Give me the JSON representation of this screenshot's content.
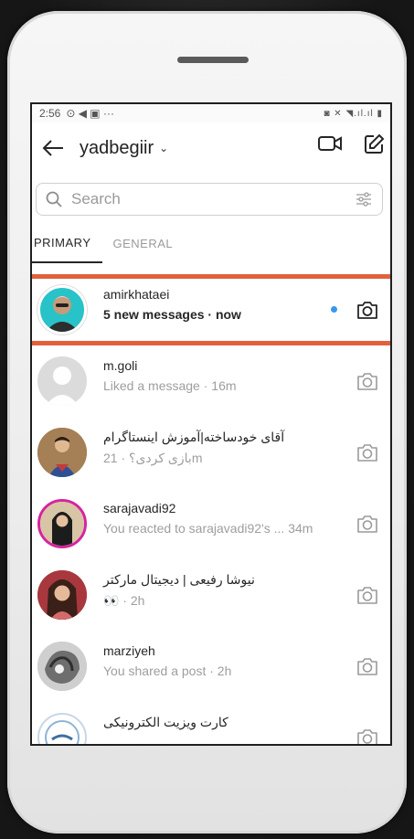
{
  "status_bar": {
    "time": "2:56",
    "extra_icons": "⊙ ◀ ▣ ···",
    "right_icons": "◙ ✕ ◥.ıl.ıl ▮"
  },
  "header": {
    "account_name": "yadbegiir",
    "chevron": "⌄"
  },
  "search": {
    "placeholder": "Search"
  },
  "tabs": [
    {
      "label": "PRIMARY",
      "active": true
    },
    {
      "label": "GENERAL",
      "active": false
    }
  ],
  "conversations": [
    {
      "name": "amirkhataei",
      "subtitle": "5 new messages · now",
      "unread": true,
      "highlighted": true
    },
    {
      "name": "m.goli",
      "subtitle": "Liked a message",
      "time": "· 16m"
    },
    {
      "name": "آقای خودساخته|آموزش اینستاگرام",
      "subtitle": "بازی کردی؟",
      "time": "· 21m"
    },
    {
      "name": "sarajavadi92",
      "subtitle": "You reacted to sarajavadi92's ...",
      "time": "34m"
    },
    {
      "name": "نیوشا رفیعی | دیجیتال مارکتر",
      "subtitle": "👀",
      "time": "· 2h"
    },
    {
      "name": "marziyeh",
      "subtitle": "You shared a post",
      "time": "· 2h"
    },
    {
      "name": "کارت ویزیت الکترونیکی",
      "subtitle": ""
    }
  ],
  "colors": {
    "highlight": "#e2613d",
    "unread_dot": "#3897f0",
    "story_ring": "#d6249f"
  }
}
